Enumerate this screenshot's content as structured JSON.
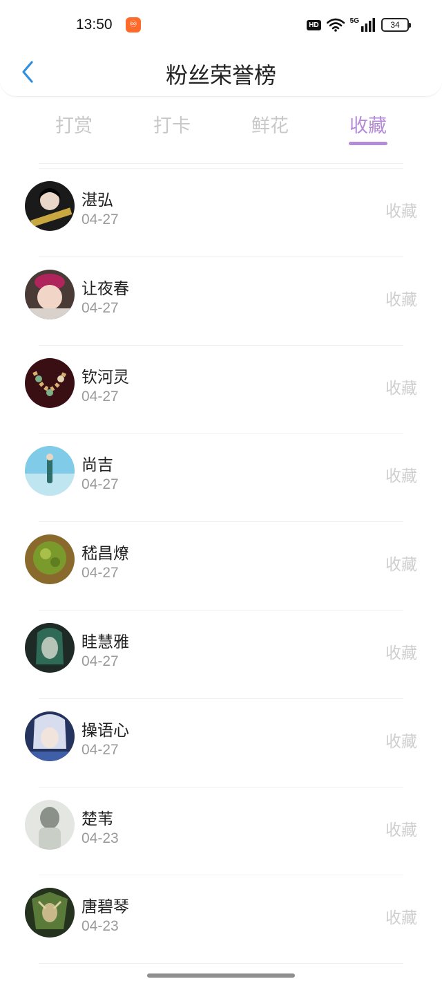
{
  "status_bar": {
    "time": "13:50",
    "app_badge_icon": "app-notification-icon",
    "hd": "HD",
    "network": "5G",
    "battery": "34"
  },
  "header": {
    "title": "粉丝荣誉榜",
    "back_icon": "chevron-left-icon"
  },
  "tabs": [
    {
      "label": "打赏",
      "active": false
    },
    {
      "label": "打卡",
      "active": false
    },
    {
      "label": "鲜花",
      "active": false
    },
    {
      "label": "收藏",
      "active": true
    }
  ],
  "accent_color": "#b58ad6",
  "fans": [
    {
      "name": "湛弘",
      "date": "04-27",
      "action": "收藏"
    },
    {
      "name": "让夜春",
      "date": "04-27",
      "action": "收藏"
    },
    {
      "name": "钦河灵",
      "date": "04-27",
      "action": "收藏"
    },
    {
      "name": "尚吉",
      "date": "04-27",
      "action": "收藏"
    },
    {
      "name": "嵇昌燎",
      "date": "04-27",
      "action": "收藏"
    },
    {
      "name": "眭慧雅",
      "date": "04-27",
      "action": "收藏"
    },
    {
      "name": "操语心",
      "date": "04-27",
      "action": "收藏"
    },
    {
      "name": "楚苇",
      "date": "04-23",
      "action": "收藏"
    },
    {
      "name": "唐碧琴",
      "date": "04-23",
      "action": "收藏"
    }
  ]
}
